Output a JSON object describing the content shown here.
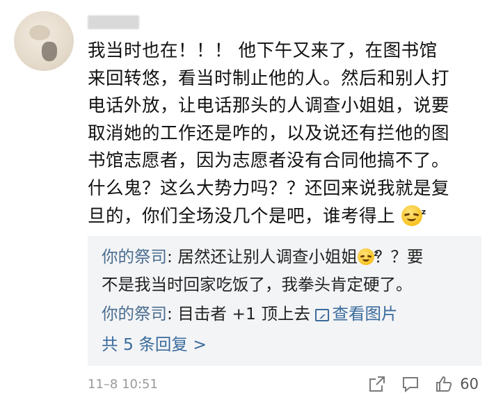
{
  "comment": {
    "username": "████",
    "lines": [
      "我当时也在！！！ 他下午又来了，在图书馆",
      "来回转悠，看当时制止他的人。然后和别人打",
      "电话外放，让电话那头的人调查小姐姐，说要",
      "取消她的工作还是咋的，以及说还有拦他的图",
      "书馆志愿者，因为志愿者没有合同他搞不了。",
      "什么鬼？这么大势力吗？？还回来说我就是复",
      "旦的，你们全场没几个是吧，谁考得上"
    ],
    "emoji": "sleepy-face-emoji"
  },
  "replies": [
    {
      "author": "你的祭司",
      "text_before_emoji": ": 居然还让别人调查小姐姐",
      "emoji": "sleepy-face-emoji",
      "text_after_emoji": "？？要",
      "line2": "不是我当时回家吃饭了，我拳头肯定硬了。"
    },
    {
      "author": "你的祭司",
      "text": ": 目击者 +1 顶上去 ",
      "link": "查看图片",
      "link_icon": "image-icon"
    }
  ],
  "more_replies": "共 5 条回复 >",
  "footer": {
    "time": "11–8 10:51",
    "like_count": "60",
    "icons": [
      "share-icon",
      "comment-icon",
      "like-icon"
    ]
  },
  "colors": {
    "author": "#4a6d8e",
    "link": "#3a6b9c",
    "reply_bg": "#f3f4f6",
    "meta": "#9a9a9a"
  }
}
